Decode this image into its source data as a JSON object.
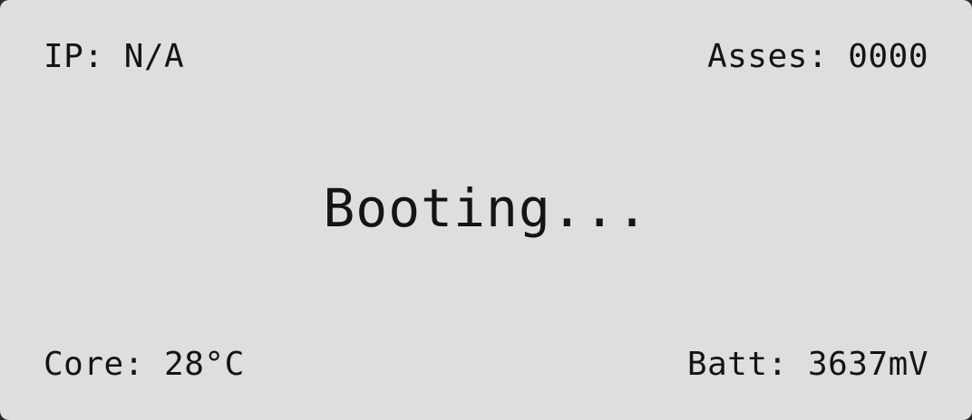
{
  "status": {
    "main_message": "Booting..."
  },
  "network": {
    "ip_label": "IP: ",
    "ip_value": "N/A"
  },
  "assets": {
    "label": "Asses: ",
    "value": "0000"
  },
  "core": {
    "label": "Core: ",
    "value": "28°C"
  },
  "battery": {
    "label": "Batt: ",
    "value": "3637mV"
  },
  "colors": {
    "background": "#dedede",
    "text": "#141414"
  }
}
